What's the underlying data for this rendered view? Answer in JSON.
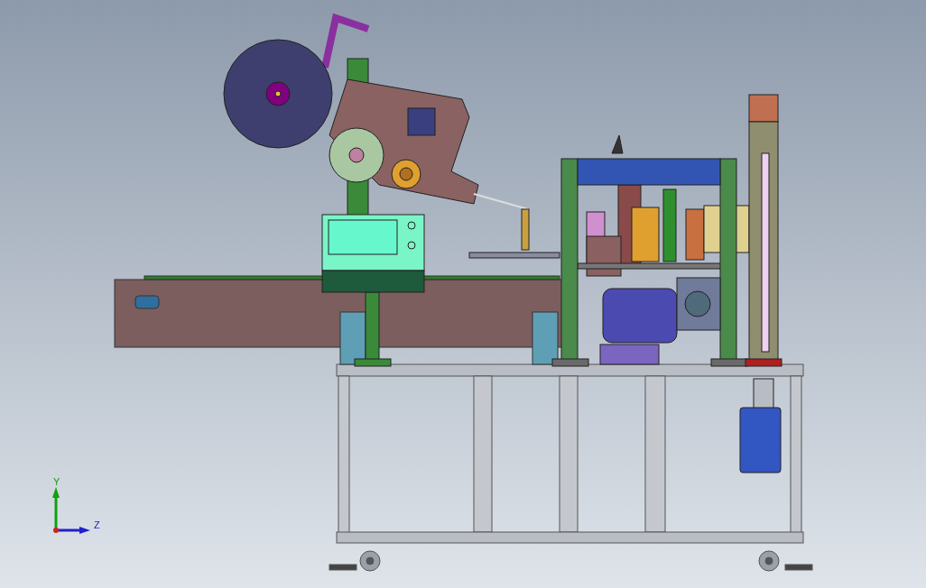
{
  "viewport": {
    "triad": {
      "axes": [
        {
          "label": "Y",
          "kind": "vertical"
        },
        {
          "label": "Z",
          "kind": "horizontal"
        }
      ]
    }
  }
}
